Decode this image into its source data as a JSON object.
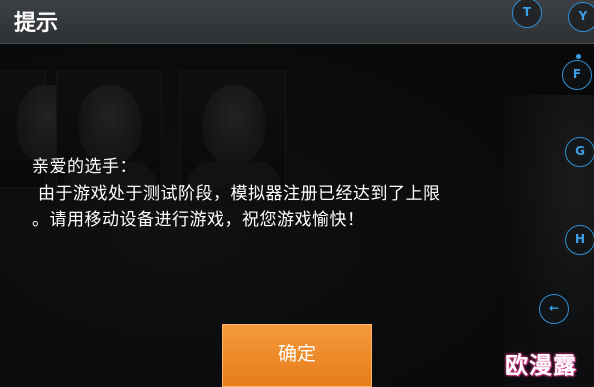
{
  "dialog": {
    "title": "提示",
    "message": {
      "line1": "亲爱的选手：",
      "line2": "由于游戏处于测试阶段，模拟器注册已经达到了上限",
      "line3": "。请用移动设备进行游戏，祝您游戏愉快！"
    },
    "confirm_label": "确定"
  },
  "keys": {
    "t": "T",
    "y": "Y",
    "f": "F",
    "g": "G",
    "h": "H",
    "back": "←"
  },
  "watermark": "欧漫露",
  "colors": {
    "accent_orange": "#f08a2a",
    "key_blue": "#2f8fd4",
    "header_bg": "#36393c"
  }
}
